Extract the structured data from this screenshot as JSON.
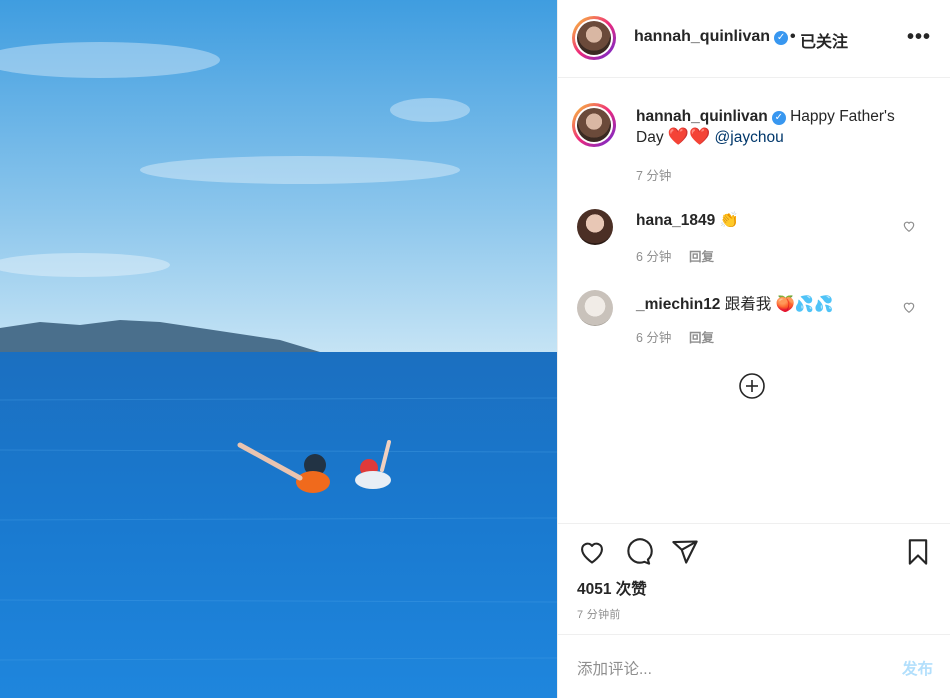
{
  "header": {
    "username": "hannah_quinlivan",
    "separator": "•",
    "follow_label": "已关注",
    "more_label": "•••"
  },
  "caption": {
    "username": "hannah_quinlivan",
    "text": "Happy Father's Day",
    "hearts": "❤️❤️",
    "mention": "@jaychou",
    "time": "7 分钟"
  },
  "comments": [
    {
      "username": "hana_1849",
      "text": "👏",
      "time": "6 分钟",
      "reply": "回复"
    },
    {
      "username": "_miechin12",
      "text": "跟着我 🍑💦💦",
      "time": "6 分钟",
      "reply": "回复"
    }
  ],
  "likes": "4051 次赞",
  "posted": "7 分钟前",
  "comment_input": {
    "placeholder": "添加评论...",
    "post_label": "发布"
  },
  "colors": {
    "verified": "#3897f0",
    "mention": "#00376b",
    "post_disabled": "#b2dffc",
    "muted": "#8e8e8e"
  },
  "icons": [
    "more-icon",
    "verified-icon",
    "heart-icon",
    "comment-icon",
    "share-icon",
    "bookmark-icon",
    "add-comment-icon"
  ]
}
